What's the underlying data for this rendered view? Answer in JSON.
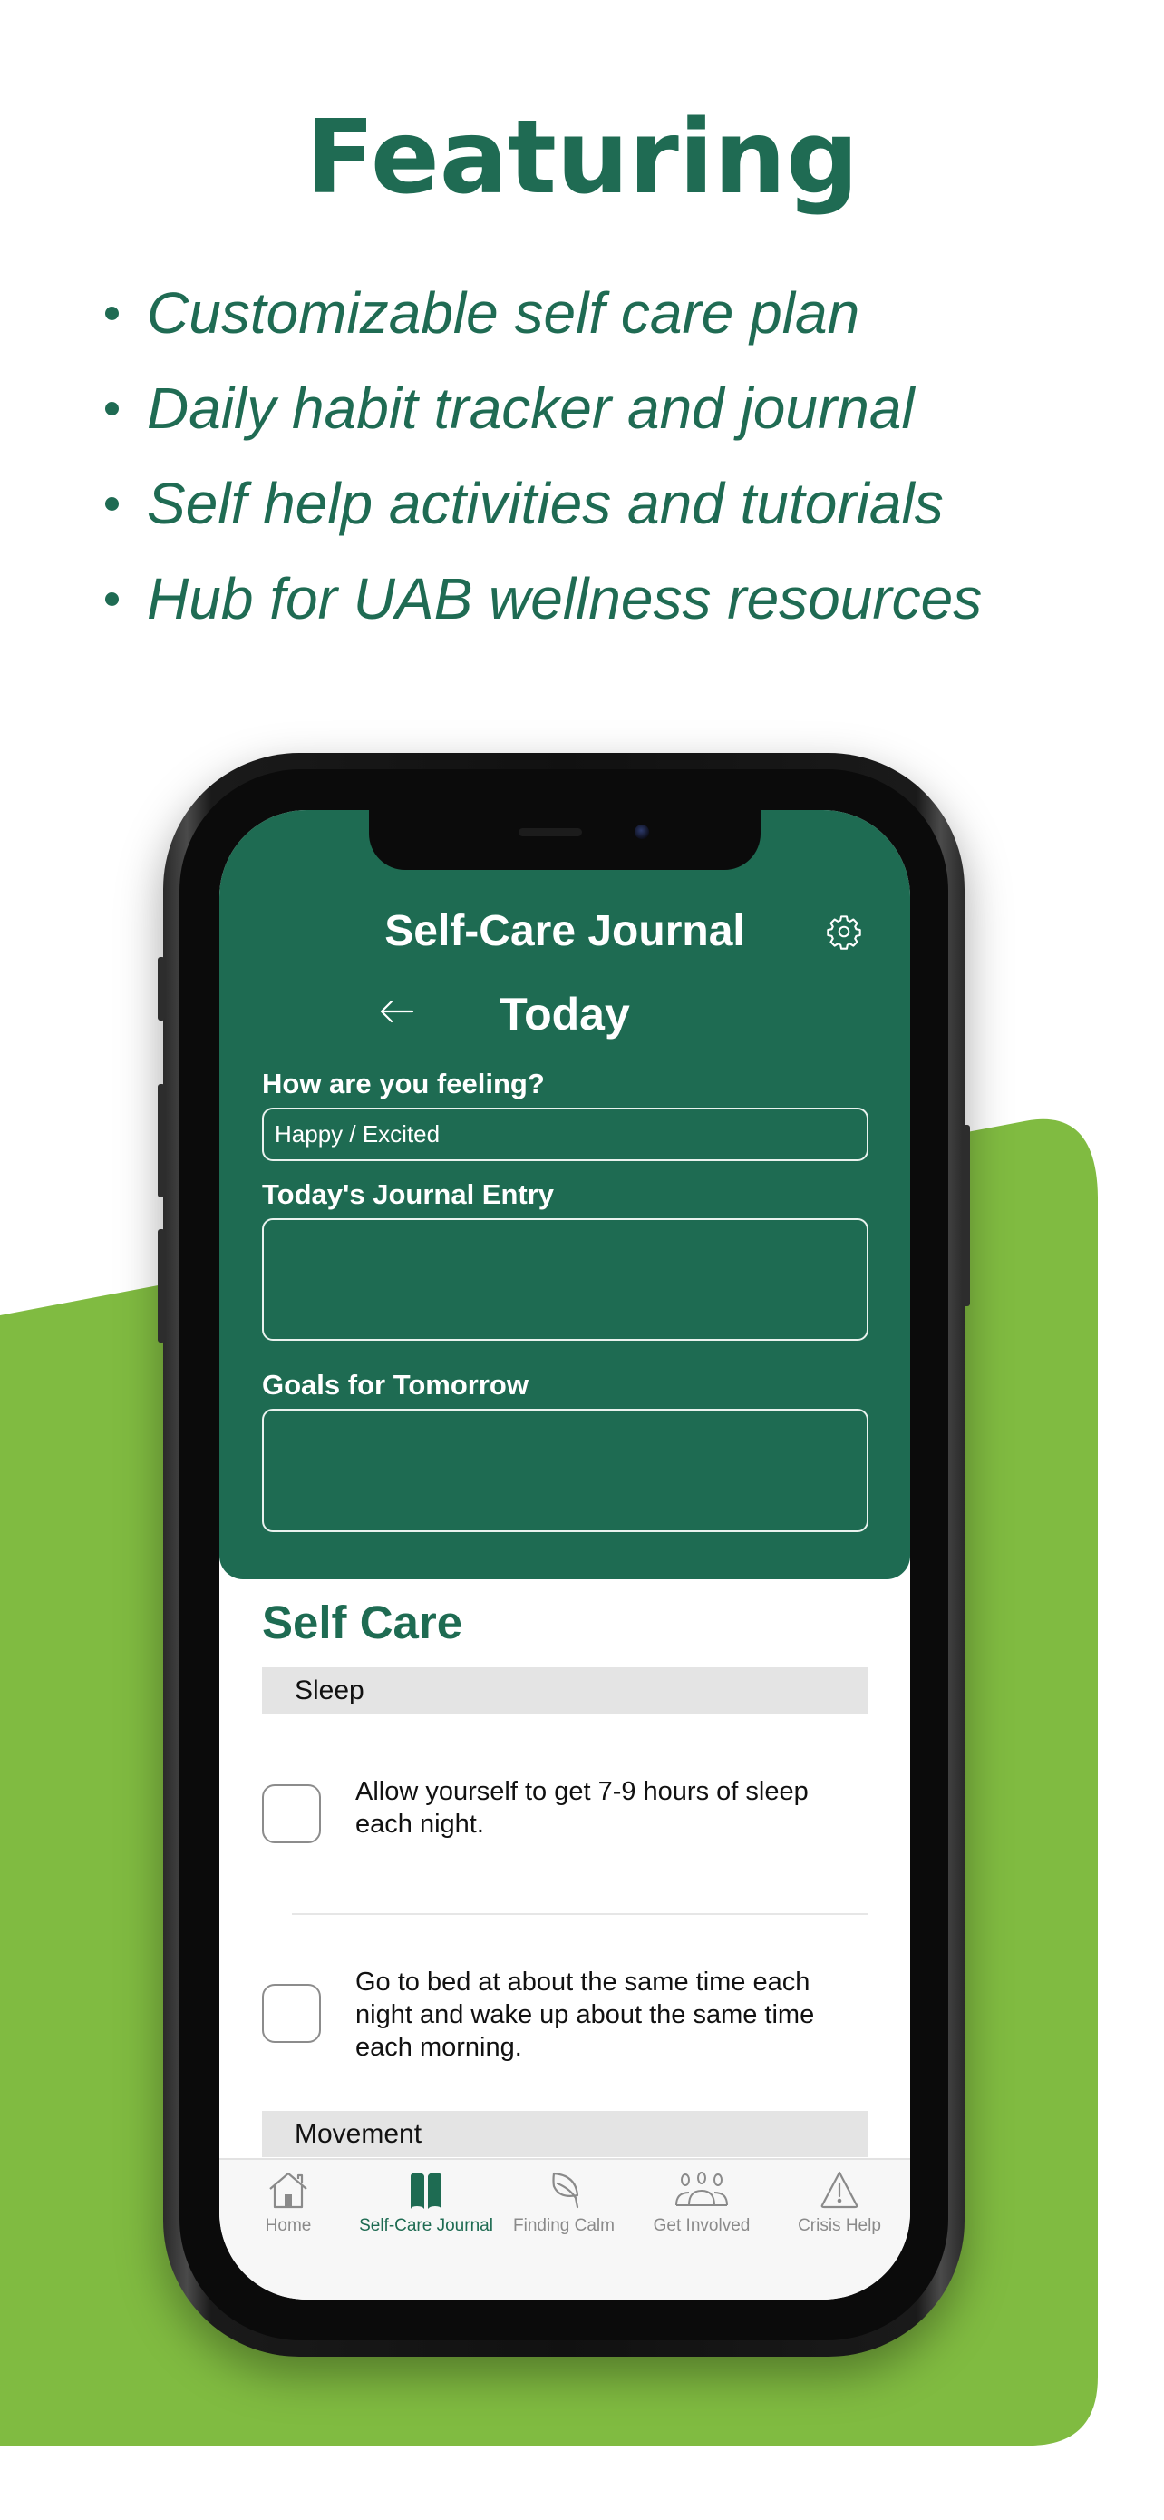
{
  "promo": {
    "title": "Featuring",
    "features": [
      "Customizable self care plan",
      "Daily habit tracker and journal",
      "Self help activities and tutorials",
      "Hub for UAB wellness resources"
    ]
  },
  "colors": {
    "brand_green": "#1e6b52",
    "accent_green": "#80bb41",
    "category_bg": "#e4e4e4",
    "tab_inactive": "#8a8a8a"
  },
  "app": {
    "title": "Self-Care Journal",
    "settings_icon": "gear-icon",
    "back_icon": "arrow-left-icon",
    "page_title": "Today",
    "form": {
      "feeling_label": "How are you feeling?",
      "feeling_value": "Happy / Excited",
      "journal_label": "Today's Journal Entry",
      "journal_value": "",
      "goals_label": "Goals for Tomorrow",
      "goals_value": ""
    },
    "self_care": {
      "title": "Self Care",
      "categories": [
        {
          "name": "Sleep",
          "tasks": [
            {
              "text": "Allow yourself to get 7-9 hours of sleep each night.",
              "checked": false
            },
            {
              "text": "Go to bed at about the same time each night and wake up about the same time each morning.",
              "checked": false
            }
          ]
        },
        {
          "name": "Movement",
          "tasks": []
        }
      ]
    },
    "tabs": [
      {
        "label": "Home",
        "icon": "home-icon",
        "active": false
      },
      {
        "label": "Self-Care Journal",
        "icon": "book-icon",
        "active": true
      },
      {
        "label": "Finding Calm",
        "icon": "leaf-icon",
        "active": false
      },
      {
        "label": "Get Involved",
        "icon": "people-icon",
        "active": false
      },
      {
        "label": "Crisis Help",
        "icon": "warning-icon",
        "active": false
      }
    ]
  }
}
